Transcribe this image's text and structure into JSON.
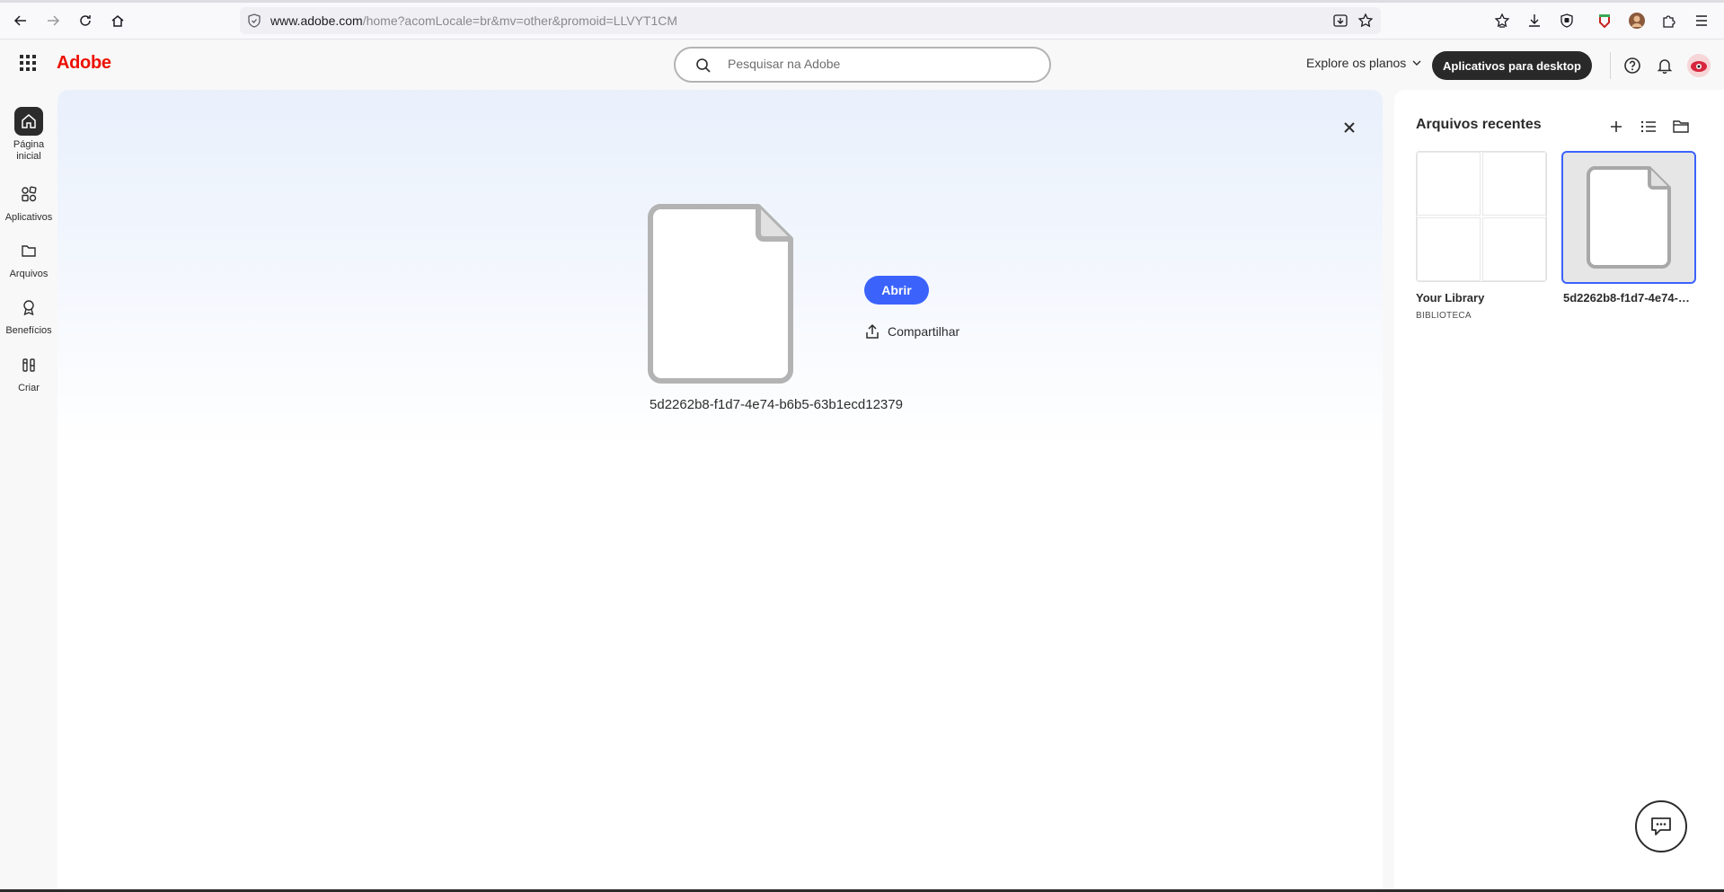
{
  "browser": {
    "url_host": "www.adobe.com",
    "url_path": "/home?acomLocale=br&mv=other&promoid=LLVYT1CM"
  },
  "header": {
    "logo": "Adobe",
    "search_placeholder": "Pesquisar na Adobe",
    "plans_label": "Explore os planos",
    "desktop_apps_label": "Aplicativos para desktop"
  },
  "rail": {
    "items": [
      {
        "label": "Página inicial",
        "icon": "home-icon",
        "active": true
      },
      {
        "label": "Aplicativos",
        "icon": "apps-icon",
        "active": false
      },
      {
        "label": "Arquivos",
        "icon": "folder-icon",
        "active": false
      },
      {
        "label": "Benefícios",
        "icon": "award-icon",
        "active": false
      },
      {
        "label": "Criar",
        "icon": "create-icon",
        "active": false
      }
    ]
  },
  "preview": {
    "file_name": "5d2262b8-f1d7-4e74-b6b5-63b1ecd12379",
    "open_label": "Abrir",
    "share_label": "Compartilhar"
  },
  "recent": {
    "title": "Arquivos recentes",
    "cards": [
      {
        "name": "Your Library",
        "subtitle": "BIBLIOTECA"
      },
      {
        "name": "5d2262b8-f1d7-4e74-b6b5-63b1ecd12379",
        "subtitle": ""
      }
    ]
  },
  "colors": {
    "accent": "#3b63fb",
    "brand": "#eb1000",
    "dark_button": "#292929"
  }
}
